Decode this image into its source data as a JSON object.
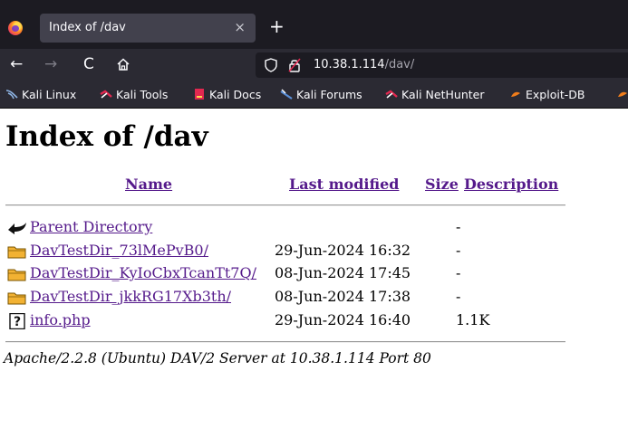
{
  "browser": {
    "tab_title": "Index of /dav",
    "tab_close": "×",
    "new_tab": "+",
    "back": "←",
    "forward": "→",
    "reload": "C",
    "url_host": "10.38.1.114",
    "url_path": "/dav/"
  },
  "bookmarks": [
    {
      "label": "Kali Linux",
      "icon": "kali-dragon-icon"
    },
    {
      "label": "Kali Tools",
      "icon": "kali-tools-icon"
    },
    {
      "label": "Kali Docs",
      "icon": "kali-docs-icon"
    },
    {
      "label": "Kali Forums",
      "icon": "kali-forums-icon"
    },
    {
      "label": "Kali NetHunter",
      "icon": "kali-nethunter-icon"
    },
    {
      "label": "Exploit-DB",
      "icon": "exploit-db-icon"
    }
  ],
  "page": {
    "heading": "Index of /dav",
    "columns": {
      "name": "Name",
      "last_modified": "Last modified",
      "size": "Size",
      "description": "Description"
    },
    "rows": [
      {
        "name": "Parent Directory",
        "modified": "",
        "size": "-",
        "icon": "back-arrow-icon"
      },
      {
        "name": "DavTestDir_73lMePvB0/",
        "modified": "29-Jun-2024 16:32",
        "size": "-",
        "icon": "folder-icon"
      },
      {
        "name": "DavTestDir_KyIoCbxTcanTt7Q/",
        "modified": "08-Jun-2024 17:45",
        "size": "-",
        "icon": "folder-icon"
      },
      {
        "name": "DavTestDir_jkkRG17Xb3th/",
        "modified": "08-Jun-2024 17:38",
        "size": "-",
        "icon": "folder-icon"
      },
      {
        "name": "info.php",
        "modified": "29-Jun-2024 16:40",
        "size": "1.1K",
        "icon": "unknown-file-icon"
      }
    ],
    "footer": "Apache/2.2.8 (Ubuntu) DAV/2 Server at 10.38.1.114 Port 80"
  },
  "colors": {
    "tabbar_bg": "#1c1b22",
    "toolbar_bg": "#2b2a33",
    "link_visited": "#551a8b"
  }
}
